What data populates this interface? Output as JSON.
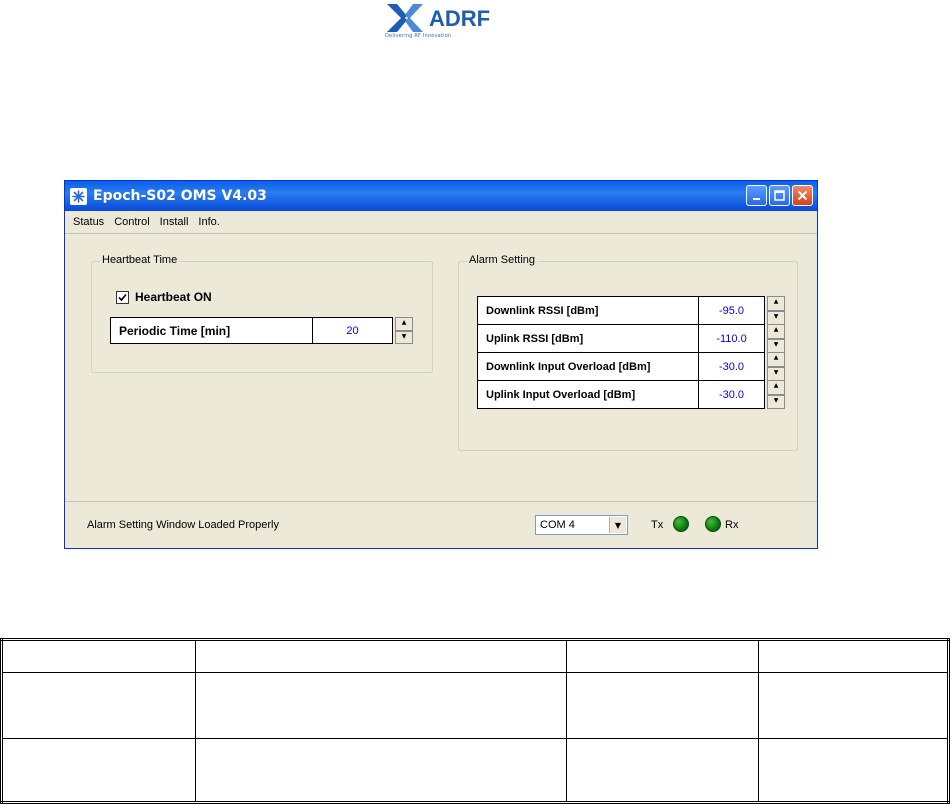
{
  "logo": {
    "text": "ADRF",
    "tagline": "Delivering RF Innovation",
    "brand_color": "#1e5db5"
  },
  "window": {
    "title": "Epoch-S02 OMS V4.03",
    "app_icon": "snowflake-icon",
    "controls": [
      "minimize-icon",
      "maximize-icon",
      "close-icon"
    ],
    "menu": [
      {
        "label": "Status"
      },
      {
        "label": "Control"
      },
      {
        "label": "Install"
      },
      {
        "label": "Info."
      }
    ]
  },
  "heartbeat": {
    "title": "Heartbeat Time",
    "checkbox_label": "Heartbeat ON",
    "checked": true,
    "periodic_label": "Periodic Time [min]",
    "periodic_value": "20"
  },
  "alarm": {
    "title": "Alarm Setting",
    "rows": [
      {
        "label": "Downlink RSSI  [dBm]",
        "value": "-95.0"
      },
      {
        "label": "Uplink RSSI  [dBm]",
        "value": "-110.0"
      },
      {
        "label": "Downlink Input Overload [dBm]",
        "value": "-30.0"
      },
      {
        "label": "Uplink Input Overload [dBm]",
        "value": "-30.0"
      }
    ]
  },
  "statusbar": {
    "message": "Alarm Setting Window Loaded Properly",
    "com_port": "COM 4",
    "tx_label": "Tx",
    "rx_label": "Rx",
    "led_color": "#1a8c1a"
  },
  "doc_table": {
    "rows": 3,
    "cols": 4
  }
}
